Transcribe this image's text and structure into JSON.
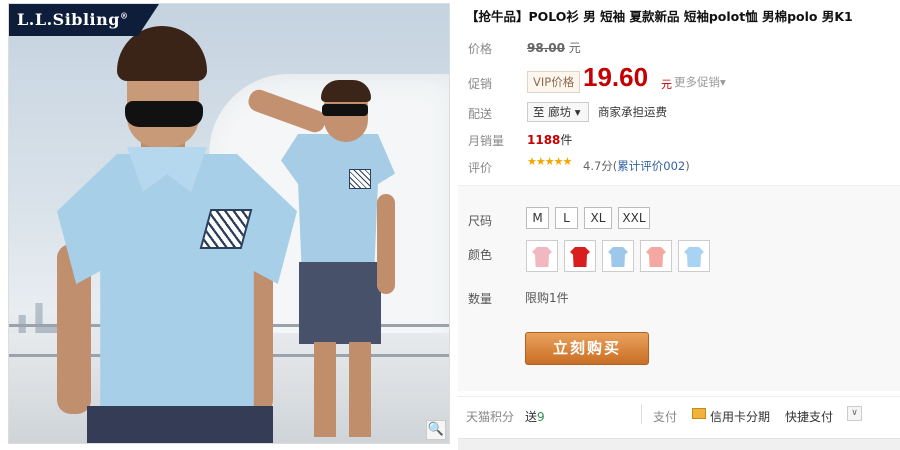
{
  "brand": {
    "logo_text": "L.L.Sibling",
    "logo_mark": "®"
  },
  "product": {
    "title": "【抢牛品】POLO衫 男 短袖 夏款新品 短袖polot恤 男棉polo 男K1"
  },
  "labels": {
    "price": "价格",
    "promo": "促销",
    "delivery": "配送",
    "monthly_sales": "月销量",
    "rating": "评价",
    "size": "尺码",
    "color": "颜色",
    "quantity": "数量"
  },
  "price": {
    "original": "98.00",
    "currency": "元",
    "vip_badge": "VIP价格",
    "promo": "19.60",
    "promo_currency": "元",
    "more_promos": "更多促销▾"
  },
  "delivery": {
    "destination": "至 廊坊 ▾",
    "shipping": "商家承担运费"
  },
  "sales": {
    "count": "1188",
    "unit": "件"
  },
  "rating": {
    "stars": "★★★★★",
    "score": "4.7分",
    "reviews_open": "(",
    "reviews_link": "累计评价002",
    "reviews_close": ")"
  },
  "sizes": [
    "M",
    "L",
    "XL",
    "XXL"
  ],
  "colors": [
    {
      "name": "pink",
      "hex": "#f2b8c0"
    },
    {
      "name": "red",
      "hex": "#d81e1e"
    },
    {
      "name": "light-blue",
      "hex": "#9ec8ea"
    },
    {
      "name": "salmon",
      "hex": "#f4a8a0"
    },
    {
      "name": "sky-blue",
      "hex": "#a9d3f2"
    }
  ],
  "quantity": {
    "limit": "限购1件"
  },
  "buy_button": "立刻购买",
  "bottom_bar": {
    "points_label": "天猫积分",
    "points_prefix": "送",
    "points_value": "9",
    "pay_label": "支付",
    "credit_card": "信用卡分期",
    "quick_pay": "快捷支付",
    "expand": "∨"
  },
  "zoom_icon": "🔍"
}
